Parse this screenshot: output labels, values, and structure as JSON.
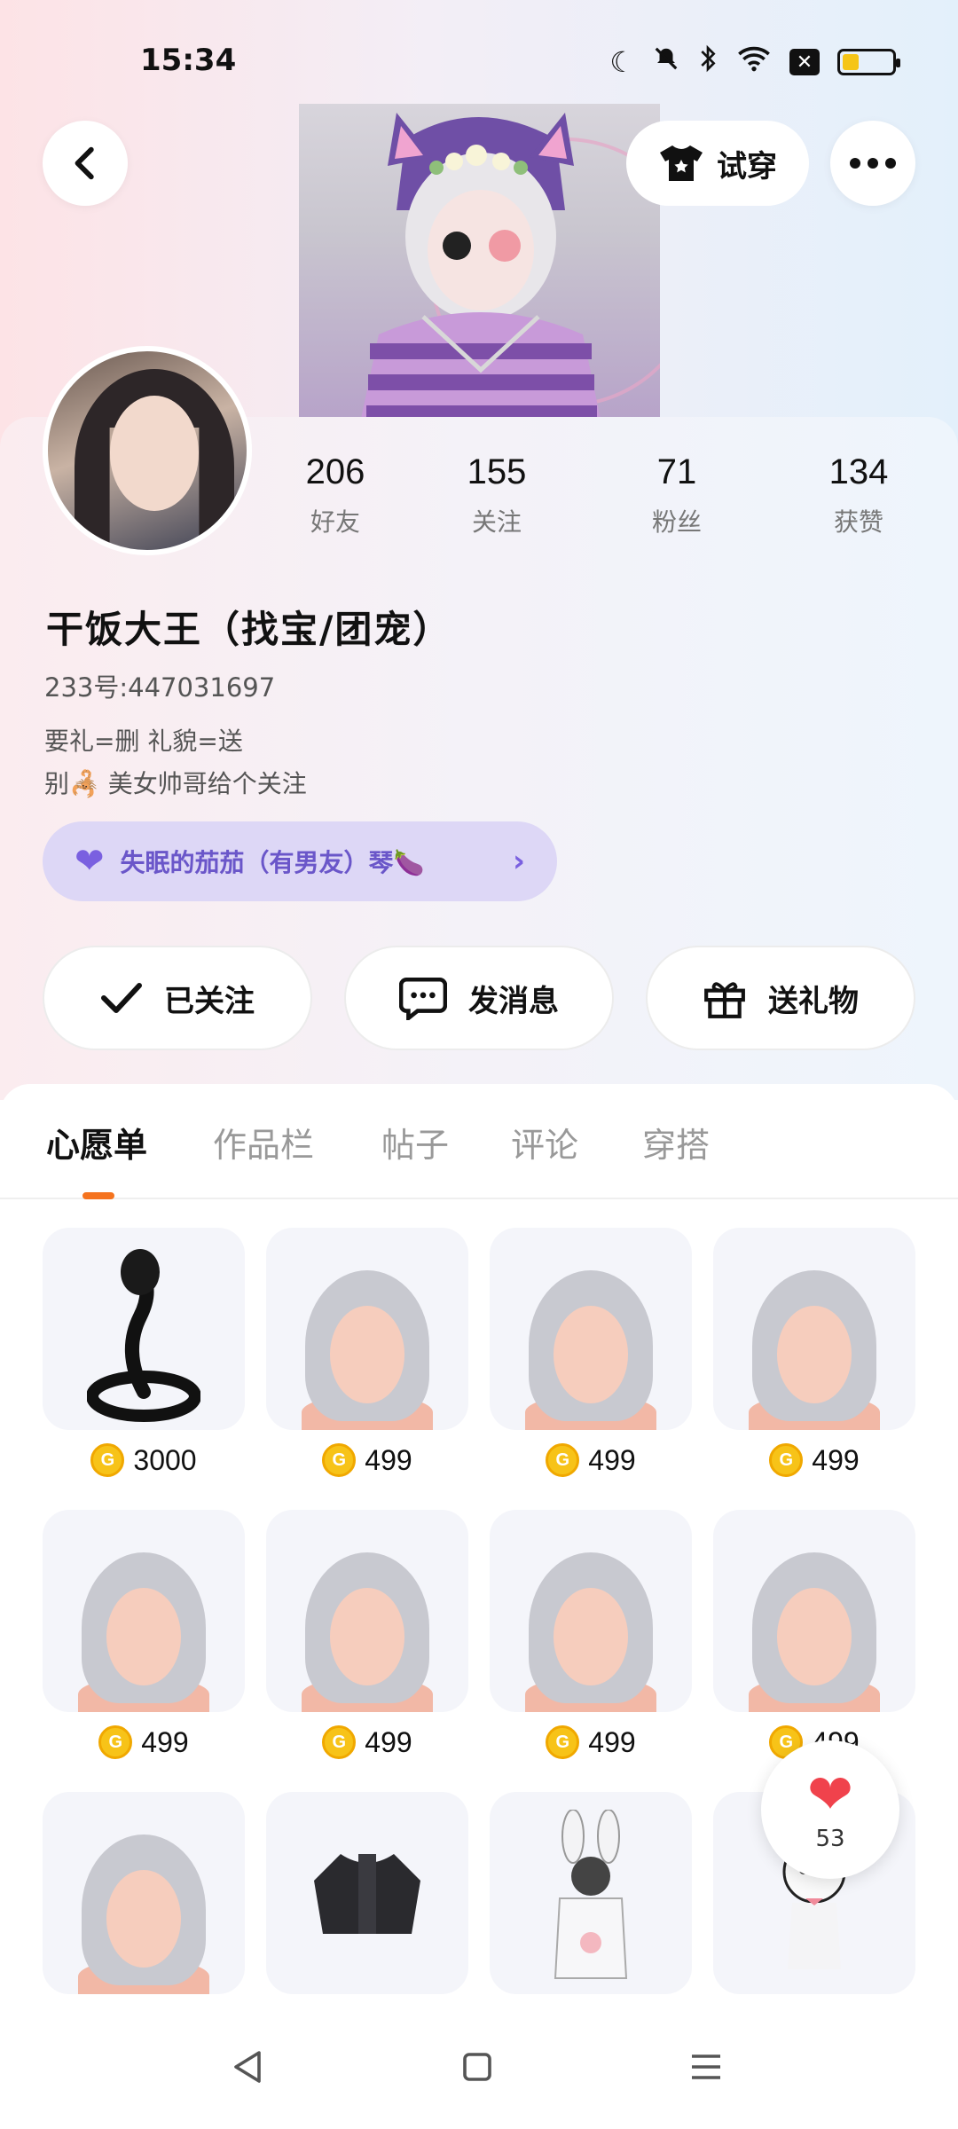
{
  "status_bar": {
    "time": "15:34",
    "icons": [
      "moon-icon",
      "mute-bell-icon",
      "bluetooth-icon",
      "wifi-icon",
      "close-box-icon",
      "battery-icon"
    ]
  },
  "header": {
    "try_on_label": "试穿"
  },
  "profile": {
    "stats": [
      {
        "value": "206",
        "label": "好友"
      },
      {
        "value": "155",
        "label": "关注"
      },
      {
        "value": "71",
        "label": "粉丝"
      },
      {
        "value": "134",
        "label": "获赞"
      }
    ],
    "name": "干饭大王（找宝/团宠）",
    "uid": "233号:447031697",
    "bio_line1": "要礼=删    礼貌=送",
    "bio_line2": "别🦂   美女帅哥给个关注",
    "cp_text": "失眠的茄茄（有男友）琴🍆"
  },
  "actions": {
    "follow_label": "已关注",
    "message_label": "发消息",
    "gift_label": "送礼物"
  },
  "tabs": [
    "心愿单",
    "作品栏",
    "帖子",
    "评论",
    "穿搭"
  ],
  "active_tab": "心愿单",
  "wishlist": [
    {
      "kind": "snake",
      "price": "3000"
    },
    {
      "kind": "hair",
      "price": "499"
    },
    {
      "kind": "hair",
      "price": "499"
    },
    {
      "kind": "hair",
      "price": "499"
    },
    {
      "kind": "hair",
      "price": "499"
    },
    {
      "kind": "hair",
      "price": "499"
    },
    {
      "kind": "hair",
      "price": "499"
    },
    {
      "kind": "hair",
      "price": "499"
    },
    {
      "kind": "hair",
      "price": ""
    },
    {
      "kind": "jacket",
      "price": ""
    },
    {
      "kind": "bunny",
      "price": ""
    },
    {
      "kind": "doll",
      "price": ""
    }
  ],
  "like_fab": {
    "count": "53"
  },
  "colors": {
    "accent": "#f5731e",
    "cp_bg": "#ddd7f6",
    "coin": "#f7c318",
    "heart": "#f0424c"
  }
}
